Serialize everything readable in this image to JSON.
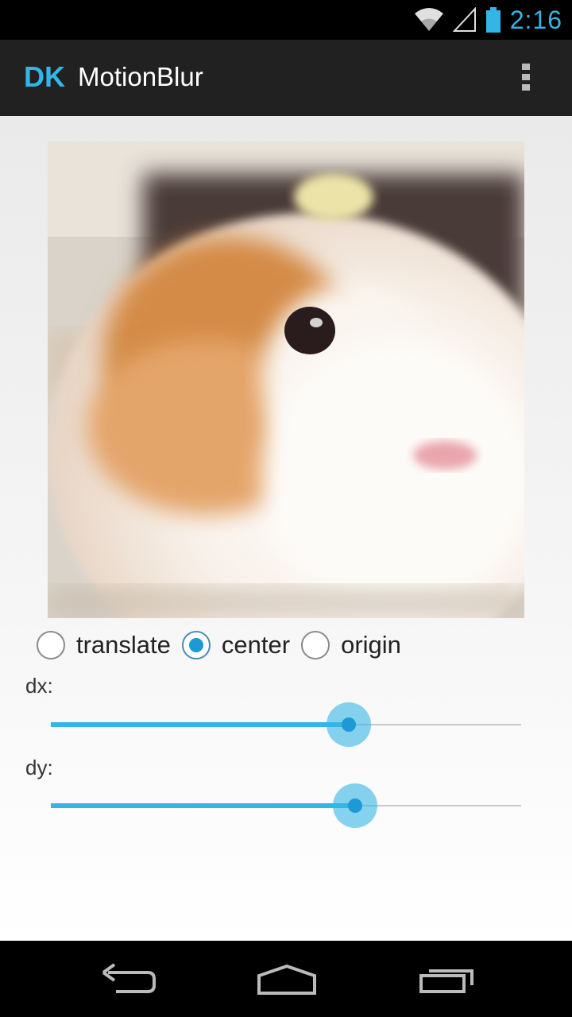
{
  "status_bar": {
    "time": "2:16",
    "icons": [
      "wifi-icon",
      "signal-icon",
      "battery-icon"
    ],
    "accent_color": "#33b5e5"
  },
  "action_bar": {
    "logo": "DK",
    "title": "MotionBlur",
    "overflow_icon": "overflow-menu-icon"
  },
  "options": {
    "radios": [
      {
        "label": "translate",
        "checked": false
      },
      {
        "label": "center",
        "checked": true
      },
      {
        "label": "origin",
        "checked": false
      }
    ]
  },
  "sliders": [
    {
      "label": "dx:",
      "value_fraction": 0.633
    },
    {
      "label": "dy:",
      "value_fraction": 0.647
    }
  ],
  "nav_bar": {
    "icons": [
      "back-icon",
      "home-icon",
      "recent-apps-icon"
    ]
  },
  "colors": {
    "accent": "#33b5e5",
    "action_bar_bg": "#212121",
    "radio_checked": "#1d9ad6"
  }
}
